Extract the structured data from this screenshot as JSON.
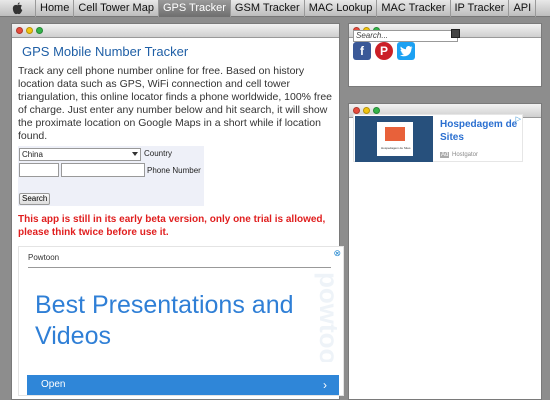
{
  "nav": {
    "tabs": [
      {
        "label": "Home"
      },
      {
        "label": "Cell Tower Map"
      },
      {
        "label": "GPS Tracker"
      },
      {
        "label": "GSM Tracker"
      },
      {
        "label": "MAC Lookup"
      },
      {
        "label": "MAC Tracker"
      },
      {
        "label": "IP Tracker"
      },
      {
        "label": "API"
      }
    ],
    "active": "GPS Tracker",
    "logo_icon": "apple-icon"
  },
  "main": {
    "title": "GPS Mobile Number Tracker",
    "intro": "Track any cell phone number online for free. Based on history location data such as GPS, WiFi connection and cell tower triangulation, this online locator finds a phone worldwide, 100% free of charge. Just enter any number below and hit search, it will show the proximate location on Google Maps in a short while if location found.",
    "form": {
      "country_value": "China",
      "country_label": "Country",
      "phone_label": "Phone Number",
      "search_label": "Search"
    },
    "warning": "This app is still in its early beta version, only one trial is allowed, please think twice before use it.",
    "ad": {
      "brand": "Powtoon",
      "headline": "Best Presentations and Videos",
      "watermark": "powtoon",
      "cta": "Open"
    }
  },
  "sidebar": {
    "search_placeholder": "Search...",
    "social_icons": [
      "facebook-icon",
      "pinterest-icon",
      "twitter-icon"
    ],
    "ad": {
      "title": "Hospedagem de Sites",
      "badge": "Ad",
      "source": "Hostgator",
      "tile_text": "Hospedagem de Sites"
    }
  },
  "colors": {
    "title_blue": "#1f5fa6",
    "warning_red": "#e01e1e",
    "ad_blue": "#2f7fd6",
    "active_tab": "#6e6e6e"
  }
}
